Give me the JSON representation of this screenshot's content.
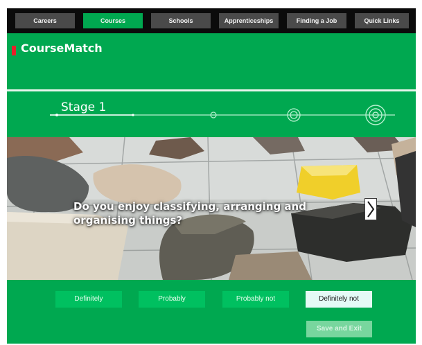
{
  "nav": {
    "items": [
      {
        "label": "Careers"
      },
      {
        "label": "Courses",
        "active": true
      },
      {
        "label": "Schools"
      },
      {
        "label": "Apprenticeships"
      },
      {
        "label": "Finding a Job"
      },
      {
        "label": "Quick Links"
      }
    ]
  },
  "header": {
    "brand": "CourseMatch"
  },
  "progress": {
    "label": "Stage 1",
    "current_stage": 1,
    "total_stages": 5
  },
  "question": {
    "text": "Do you enjoy classifying, arranging and organising things?",
    "next_icon": "chevron-right-icon"
  },
  "answers": [
    {
      "label": "Definitely"
    },
    {
      "label": "Probably"
    },
    {
      "label": "Probably not"
    },
    {
      "label": "Definitely not",
      "selected": true
    }
  ],
  "footer": {
    "save_exit_label": "Save and Exit",
    "save_exit_enabled": false
  },
  "colors": {
    "brand_green": "#00a850",
    "accent_red": "#e8202a",
    "nav_bg": "#0b0b0b",
    "nav_button": "#4a4a4a"
  }
}
